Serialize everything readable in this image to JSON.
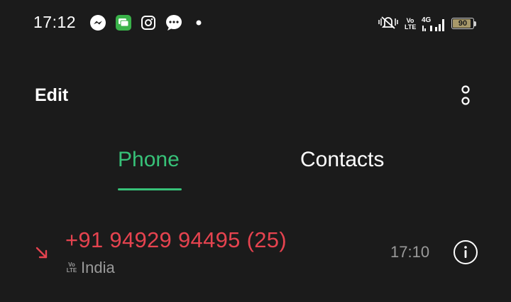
{
  "status_bar": {
    "time": "17:12",
    "notification_icons": [
      "messenger-icon",
      "messages-icon",
      "instagram-icon",
      "chat-icon",
      "dot-icon"
    ],
    "volte": "Vo LTE",
    "network": "4G",
    "battery_percent": "90",
    "battery_level": 0.9
  },
  "app_bar": {
    "edit_label": "Edit",
    "more_icon": "more-vert-icon"
  },
  "tabs": [
    {
      "label": "Phone",
      "active": true
    },
    {
      "label": "Contacts",
      "active": false
    }
  ],
  "call_log": [
    {
      "type": "missed-incoming-icon",
      "number": "+91 94929 94495 (25)",
      "volte": "Vo LTE",
      "location": "India",
      "time": "17:10",
      "info_icon": "info-icon"
    }
  ],
  "colors": {
    "background": "#1b1b1b",
    "accent": "#37c178",
    "missed": "#e5434f",
    "secondary_text": "#9a9a9a",
    "battery": "#a8996a"
  }
}
